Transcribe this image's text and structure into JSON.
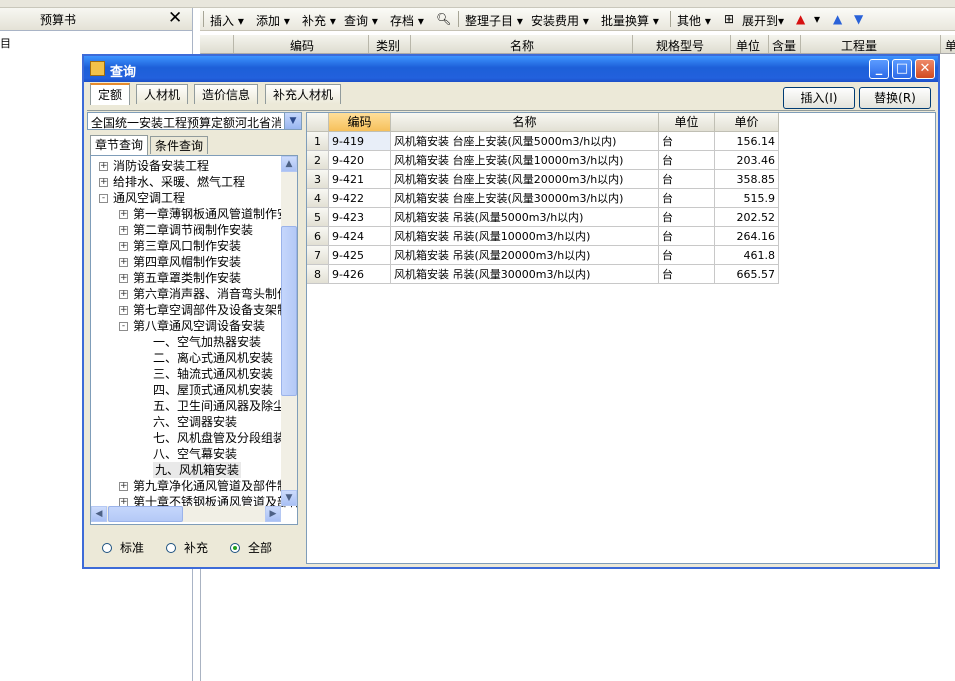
{
  "left_panel": {
    "title": "预算书",
    "close": "✕",
    "first_row": "目"
  },
  "toolbar": {
    "items": [
      {
        "label": "插入",
        "arrow": "▾"
      },
      {
        "label": "添加",
        "arrow": "▾"
      },
      {
        "label": "补充",
        "arrow": "▾"
      },
      {
        "label": "查询",
        "arrow": "▾"
      },
      {
        "label": "存档",
        "arrow": "▾"
      },
      {
        "label": "整理子目",
        "arrow": "▾"
      },
      {
        "label": "安装费用",
        "arrow": "▾"
      },
      {
        "label": "批量换算",
        "arrow": "▾"
      },
      {
        "label": "其他",
        "arrow": "▾"
      },
      {
        "label": "展开到",
        "arrow": "▾"
      }
    ]
  },
  "bg_grid": {
    "headers": [
      "编码",
      "类别",
      "名称",
      "规格型号",
      "单位",
      "含量",
      "工程量",
      "单"
    ]
  },
  "dialog": {
    "title": "查询",
    "window_buttons": {
      "minimize": "_",
      "maximize": "□",
      "close": "✕"
    },
    "tabs": [
      "定额",
      "人材机",
      "造价信息",
      "补充人材机"
    ],
    "insert_button": "插入(I)",
    "replace_button": "替换(R)",
    "library": "全国统一安装工程预算定额河北省消耗量定额",
    "search_tabs": [
      "章节查询",
      "条件查询"
    ],
    "tree": [
      {
        "level": 0,
        "expander": "+",
        "label": "消防设备安装工程"
      },
      {
        "level": 0,
        "expander": "+",
        "label": "给排水、采暖、燃气工程"
      },
      {
        "level": 0,
        "expander": "-",
        "label": "通风空调工程"
      },
      {
        "level": 1,
        "expander": "+",
        "label": "第一章薄钢板通风管道制作安装"
      },
      {
        "level": 1,
        "expander": "+",
        "label": "第二章调节阀制作安装"
      },
      {
        "level": 1,
        "expander": "+",
        "label": "第三章风口制作安装"
      },
      {
        "level": 1,
        "expander": "+",
        "label": "第四章风帽制作安装"
      },
      {
        "level": 1,
        "expander": "+",
        "label": "第五章罩类制作安装"
      },
      {
        "level": 1,
        "expander": "+",
        "label": "第六章消声器、消音弯头制作安装"
      },
      {
        "level": 1,
        "expander": "+",
        "label": "第七章空调部件及设备支架制作安装"
      },
      {
        "level": 1,
        "expander": "-",
        "label": "第八章通风空调设备安装"
      },
      {
        "level": 2,
        "expander": "",
        "label": "一、空气加热器安装"
      },
      {
        "level": 2,
        "expander": "",
        "label": "二、离心式通风机安装"
      },
      {
        "level": 2,
        "expander": "",
        "label": "三、轴流式通风机安装"
      },
      {
        "level": 2,
        "expander": "",
        "label": "四、屋顶式通风机安装"
      },
      {
        "level": 2,
        "expander": "",
        "label": "五、卫生间通风器及除尘设备安装"
      },
      {
        "level": 2,
        "expander": "",
        "label": "六、空调器安装"
      },
      {
        "level": 2,
        "expander": "",
        "label": "七、风机盘管及分段组装式空调器安装"
      },
      {
        "level": 2,
        "expander": "",
        "label": "八、空气幕安装"
      },
      {
        "level": 2,
        "expander": "",
        "label": "九、风机箱安装",
        "selected": true
      },
      {
        "level": 1,
        "expander": "+",
        "label": "第九章净化通风管道及部件制作安装"
      },
      {
        "level": 1,
        "expander": "+",
        "label": "第十章不锈钢板通风管道及部件制作安装"
      }
    ],
    "radio_options": [
      {
        "label": "标准",
        "checked": false
      },
      {
        "label": "补充",
        "checked": false
      },
      {
        "label": "全部",
        "checked": true
      }
    ],
    "grid": {
      "headers": [
        "",
        "编码",
        "名称",
        "单位",
        "单价"
      ],
      "rows": [
        {
          "no": "1",
          "code": "9-419",
          "name": "风机箱安装 台座上安装(风量5000m3/h以内)",
          "unit": "台",
          "price": "156.14"
        },
        {
          "no": "2",
          "code": "9-420",
          "name": "风机箱安装 台座上安装(风量10000m3/h以内)",
          "unit": "台",
          "price": "203.46"
        },
        {
          "no": "3",
          "code": "9-421",
          "name": "风机箱安装 台座上安装(风量20000m3/h以内)",
          "unit": "台",
          "price": "358.85"
        },
        {
          "no": "4",
          "code": "9-422",
          "name": "风机箱安装 台座上安装(风量30000m3/h以内)",
          "unit": "台",
          "price": "515.9"
        },
        {
          "no": "5",
          "code": "9-423",
          "name": "风机箱安装 吊装(风量5000m3/h以内)",
          "unit": "台",
          "price": "202.52"
        },
        {
          "no": "6",
          "code": "9-424",
          "name": "风机箱安装 吊装(风量10000m3/h以内)",
          "unit": "台",
          "price": "264.16"
        },
        {
          "no": "7",
          "code": "9-425",
          "name": "风机箱安装 吊装(风量20000m3/h以内)",
          "unit": "台",
          "price": "461.8"
        },
        {
          "no": "8",
          "code": "9-426",
          "name": "风机箱安装 吊装(风量30000m3/h以内)",
          "unit": "台",
          "price": "665.57"
        }
      ]
    }
  }
}
